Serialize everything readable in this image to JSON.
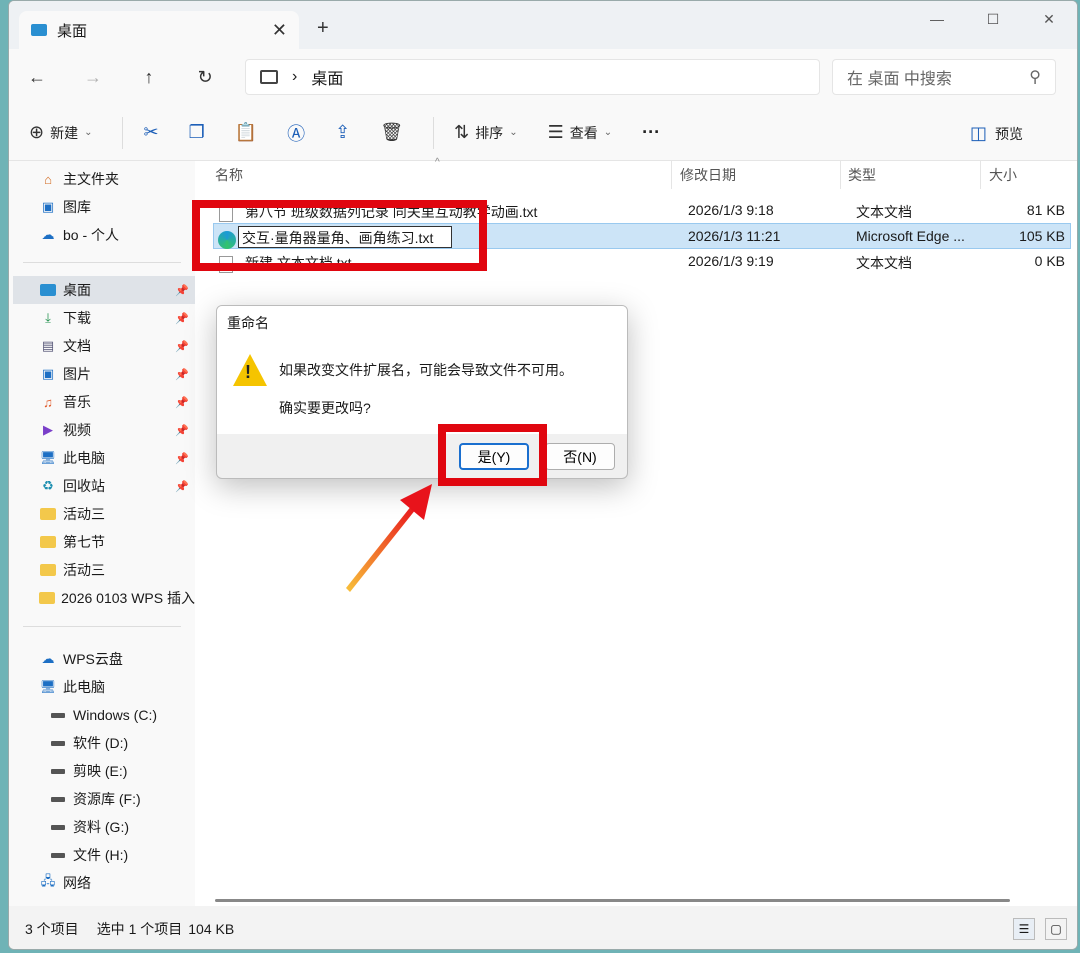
{
  "window": {
    "tab_title": "桌面",
    "new_tab": "+",
    "controls": [
      "—",
      "☐",
      "✕"
    ]
  },
  "nav": {
    "back": "←",
    "forward": "→",
    "up": "↑",
    "refresh": "↻",
    "address_icon": "monitor-icon",
    "address_sep": "›",
    "address_location": "桌面",
    "search_placeholder": "在 桌面 中搜索"
  },
  "toolbar": {
    "new_label": "新建",
    "sort_label": "排序",
    "view_label": "查看",
    "more": "···",
    "preview_label": "预览"
  },
  "sidebar": {
    "quick": [
      {
        "label": "主文件夹",
        "icon": "home-icon"
      },
      {
        "label": "图库",
        "icon": "gallery-icon"
      },
      {
        "label": "bo - 个人",
        "icon": "cloud-icon"
      }
    ],
    "pinned": [
      {
        "label": "桌面",
        "icon": "desktop-icon",
        "selected": true
      },
      {
        "label": "下载",
        "icon": "download-icon"
      },
      {
        "label": "文档",
        "icon": "document-icon"
      },
      {
        "label": "图片",
        "icon": "picture-icon"
      },
      {
        "label": "音乐",
        "icon": "music-icon"
      },
      {
        "label": "视频",
        "icon": "video-icon"
      },
      {
        "label": "此电脑",
        "icon": "computer-icon"
      },
      {
        "label": "回收站",
        "icon": "recycle-bin-icon"
      }
    ],
    "folders": [
      {
        "label": "活动三"
      },
      {
        "label": "第七节"
      },
      {
        "label": "活动三"
      },
      {
        "label": "2026 0103 WPS 插入"
      }
    ],
    "devices": [
      {
        "label": "WPS云盘",
        "icon": "wps-cloud-icon",
        "indent": false
      },
      {
        "label": "此电脑",
        "icon": "computer-icon",
        "indent": false
      },
      {
        "label": "Windows (C:)",
        "icon": "windows-drive-icon",
        "indent": true
      },
      {
        "label": "软件 (D:)",
        "icon": "drive-icon",
        "indent": true
      },
      {
        "label": "剪映 (E:)",
        "icon": "drive-icon",
        "indent": true
      },
      {
        "label": "资源库 (F:)",
        "icon": "drive-icon",
        "indent": true
      },
      {
        "label": "资料 (G:)",
        "icon": "drive-icon",
        "indent": true
      },
      {
        "label": "文件 (H:)",
        "icon": "drive-icon",
        "indent": true
      },
      {
        "label": "网络",
        "icon": "network-icon",
        "indent": false
      }
    ]
  },
  "columns": {
    "name": "名称",
    "date": "修改日期",
    "type": "类型",
    "size": "大小"
  },
  "files": [
    {
      "name": "第八节 班级数据列记录 同关里互动教学动画.txt",
      "date": "2026/1/3 9:18",
      "type": "文本文档",
      "size": "81 KB"
    },
    {
      "name": "交互·量角器量角、画角练习.txt",
      "date": "2026/1/3 11:21",
      "type": "Microsoft Edge ...",
      "size": "105 KB",
      "selected": true
    },
    {
      "name": "新建 文本文档.txt",
      "date": "2026/1/3 9:19",
      "type": "文本文档",
      "size": "0 KB"
    }
  ],
  "status": {
    "count": "3 个项目",
    "selected": "选中 1 个项目",
    "size": "104 KB"
  },
  "dialog": {
    "title": "重命名",
    "message": "如果改变文件扩展名，可能会导致文件不可用。",
    "question": "确实要更改吗?",
    "yes": "是(Y)",
    "no": "否(N)"
  },
  "colors": {
    "highlight": "#e0060f",
    "selection": "#cce4f7",
    "accent": "#1a6fcf"
  }
}
